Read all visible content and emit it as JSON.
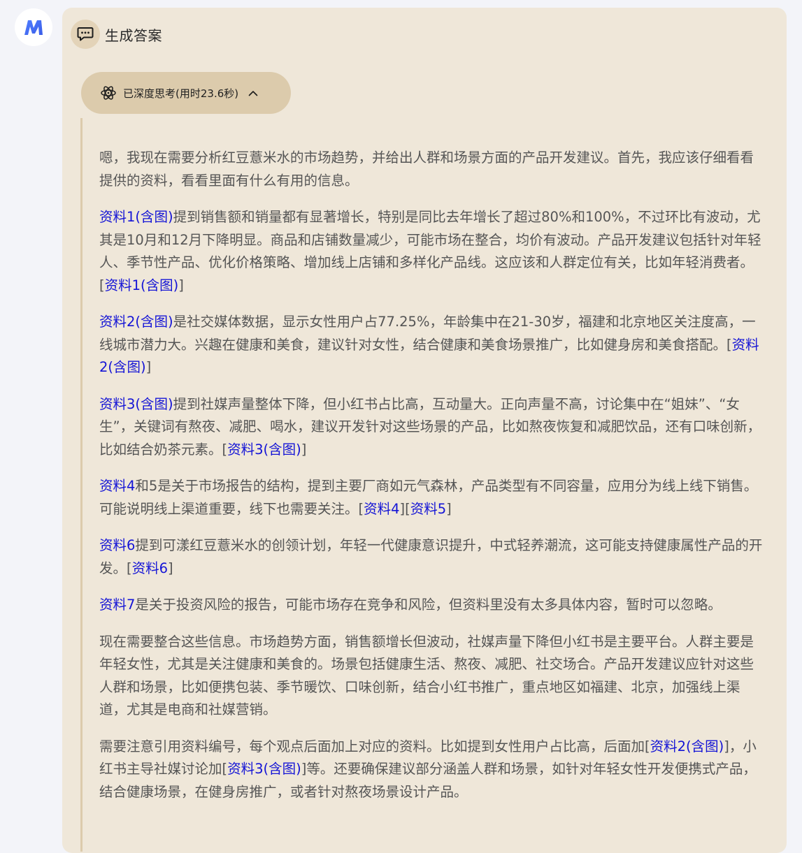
{
  "header": {
    "title": "生成答案"
  },
  "thinking": {
    "label": "已深度思考(用时23.6秒)"
  },
  "paragraphs": {
    "p1": {
      "t1": "嗯，我现在需要分析红豆薏米水的市场趋势，并给出人群和场景方面的产品开发建议。首先，我应该仔细看看提供的资料，看看里面有什么有用的信息。"
    },
    "p2": {
      "ref1": "资料1(含图)",
      "t1": "提到销售额和销量都有显著增长，特别是同比去年增长了超过80%和100%，不过环比有波动，尤其是10月和12月下降明显。商品和店铺数量减少，可能市场在整合，均价有波动。产品开发建议包括针对年轻人、季节性产品、优化价格策略、增加线上店铺和多样化产品线。这应该和人群定位有关，比如年轻消费者。[",
      "ref2": "资料1(含图)",
      "t2": "]"
    },
    "p3": {
      "ref1": "资料2(含图)",
      "t1": "是社交媒体数据，显示女性用户占77.25%，年龄集中在21-30岁，福建和北京地区关注度高，一线城市潜力大。兴趣在健康和美食，建议针对女性，结合健康和美食场景推广，比如健身房和美食搭配。[",
      "ref2": "资料2(含图)",
      "t2": "]"
    },
    "p4": {
      "ref1": "资料3(含图)",
      "t1": "提到社媒声量整体下降，但小红书占比高，互动量大。正向声量不高，讨论集中在“姐妹”、“女生”，关键词有熬夜、减肥、喝水，建议开发针对这些场景的产品，比如熬夜恢复和减肥饮品，还有口味创新，比如结合奶茶元素。[",
      "ref2": "资料3(含图)",
      "t2": "]"
    },
    "p5": {
      "ref1": "资料4",
      "t1": "和5是关于市场报告的结构，提到主要厂商如元气森林，产品类型有不同容量，应用分为线上线下销售。可能说明线上渠道重要，线下也需要关注。[",
      "ref2": "资料4",
      "t2": "][",
      "ref3": "资料5",
      "t3": "]"
    },
    "p6": {
      "ref1": "资料6",
      "t1": "提到可漾红豆薏米水的创领计划，年轻一代健康意识提升，中式轻养潮流，这可能支持健康属性产品的开发。[",
      "ref2": "资料6",
      "t2": "]"
    },
    "p7": {
      "ref1": "资料7",
      "t1": "是关于投资风险的报告，可能市场存在竞争和风险，但资料里没有太多具体内容，暂时可以忽略。"
    },
    "p8": {
      "t1": "现在需要整合这些信息。市场趋势方面，销售额增长但波动，社媒声量下降但小红书是主要平台。人群主要是年轻女性，尤其是关注健康和美食的。场景包括健康生活、熬夜、减肥、社交场合。产品开发建议应针对这些人群和场景，比如便携包装、季节暖饮、口味创新，结合小红书推广，重点地区如福建、北京，加强线上渠道，尤其是电商和社媒营销。"
    },
    "p9": {
      "t1": "需要注意引用资料编号，每个观点后面加上对应的资料。比如提到女性用户占比高，后面加[",
      "ref1": "资料2(含图)",
      "t2": "]，小红书主导社媒讨论加[",
      "ref2": "资料3(含图)",
      "t3": "]等。还要确保建议部分涵盖人群和场景，如针对年轻女性开发便携式产品，结合健康场景，在健身房推广，或者针对熬夜场景设计产品。"
    }
  }
}
